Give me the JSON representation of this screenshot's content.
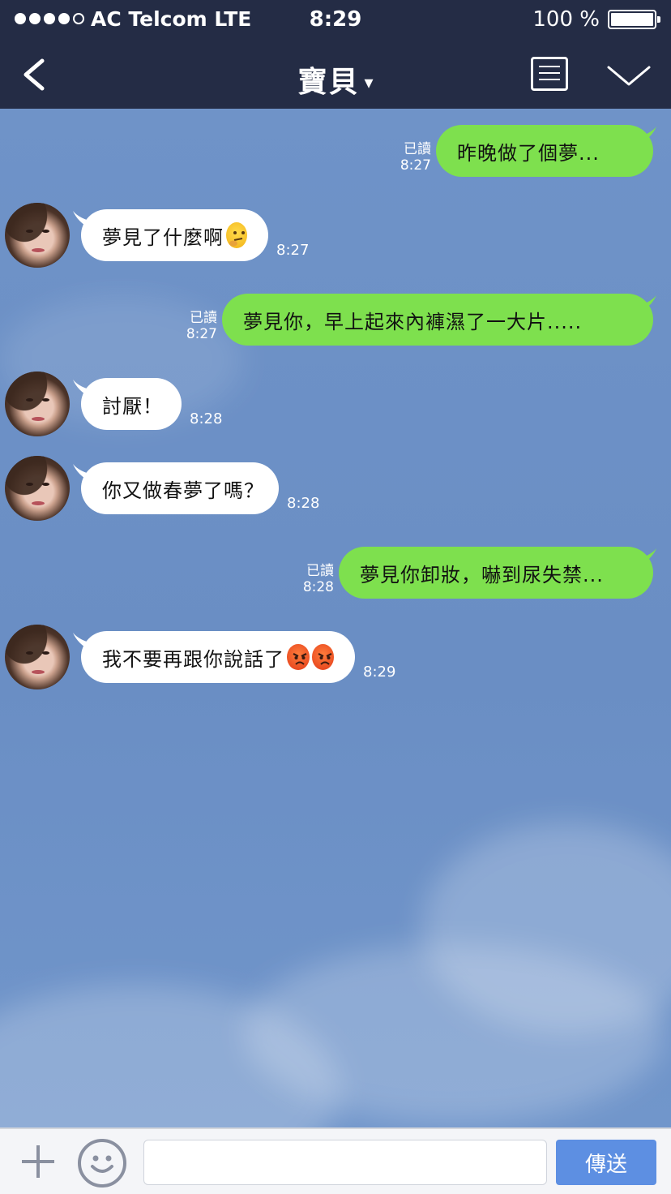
{
  "status_bar": {
    "carrier": "AC Telcom LTE",
    "time": "8:29",
    "battery": "100 %",
    "signal_bars_filled": 4,
    "signal_bars_total": 5
  },
  "nav": {
    "title": "寶貝",
    "caret": "▾",
    "icons": [
      "back-chevron-icon",
      "notes-icon",
      "collapse-chevron-icon"
    ]
  },
  "messages": [
    {
      "direction": "out",
      "text": "昨晚做了個夢...",
      "read": "已讀",
      "time": "8:27"
    },
    {
      "direction": "in",
      "text": "夢見了什麼啊",
      "emoji": [
        "thinking-face"
      ],
      "time": "8:27"
    },
    {
      "direction": "out",
      "text": "夢見你，早上起來內褲濕了一大片.....",
      "read": "已讀",
      "time": "8:27"
    },
    {
      "direction": "in",
      "text": "討厭！",
      "time": "8:28"
    },
    {
      "direction": "in",
      "text": "你又做春夢了嗎？",
      "time": "8:28"
    },
    {
      "direction": "out",
      "text": "夢見你卸妝，嚇到尿失禁...",
      "read": "已讀",
      "time": "8:28"
    },
    {
      "direction": "in",
      "text": "我不要再跟你說話了",
      "emoji": [
        "angry-face",
        "angry-face"
      ],
      "time": "8:29"
    }
  ],
  "input_bar": {
    "input_value": "",
    "send_label": "傳送"
  },
  "colors": {
    "header_bg": "#242c45",
    "chat_bg": "#6b8fc4",
    "outgoing_bubble": "#7ee04e",
    "incoming_bubble": "#ffffff",
    "send_button": "#5d8fe2"
  }
}
